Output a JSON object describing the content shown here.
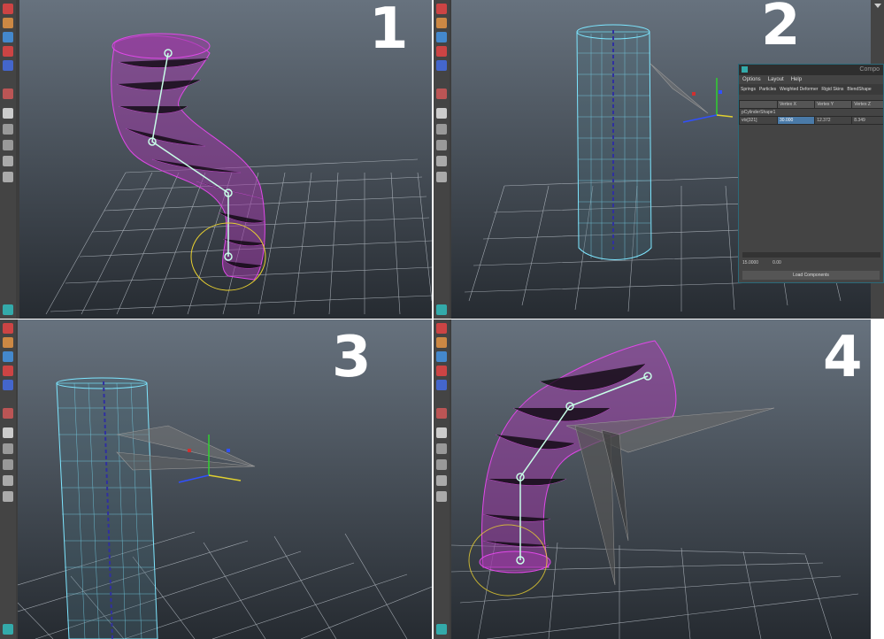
{
  "panels": [
    {
      "label": "1"
    },
    {
      "label": "2"
    },
    {
      "label": "3"
    },
    {
      "label": "4"
    }
  ],
  "component_editor": {
    "title": "Compo",
    "menu": [
      "Options",
      "Layout",
      "Help"
    ],
    "tabs": [
      "Springs",
      "Particles",
      "Weighted Deformer",
      "Rigid Skins",
      "BlendShape"
    ],
    "columns": [
      "",
      "Vertex X",
      "Vertex Y",
      "Vertex Z"
    ],
    "group_row": "pCylinderShape1",
    "vertex_row": {
      "name": "vtx[321]",
      "x": "30.000",
      "y": "12.372",
      "z": "8.349"
    },
    "footer_values": [
      "15.0000",
      "0.00"
    ],
    "load_button": "Load Components"
  },
  "colors": {
    "viewport_top": "#5f6a75",
    "viewport_bottom": "#2a2f36",
    "wire_magenta": "#d040d8",
    "wire_cyan": "#88e8ff",
    "joint": "#b8ffd8"
  }
}
